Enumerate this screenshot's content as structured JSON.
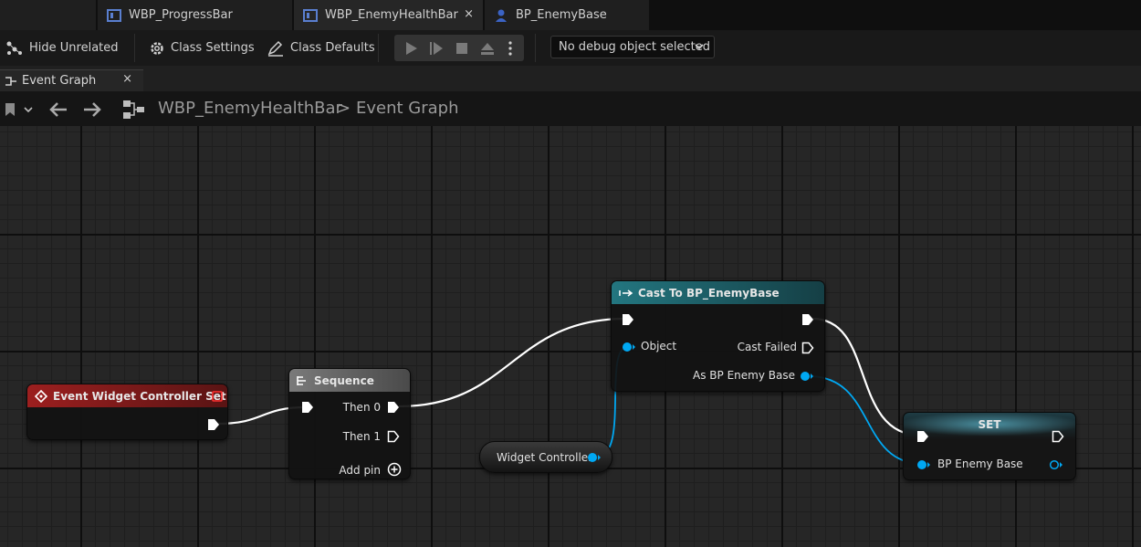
{
  "doc_tabs": [
    {
      "label": "WBP_ProgressBar",
      "icon": "widget-blueprint-icon"
    },
    {
      "label": "WBP_EnemyHealthBar",
      "icon": "widget-blueprint-icon",
      "close": "×"
    },
    {
      "label": "BP_EnemyBase",
      "icon": "actor-blueprint-icon"
    }
  ],
  "toolbar": {
    "hide_unrelated": "Hide Unrelated",
    "class_settings": "Class Settings",
    "class_defaults": "Class Defaults",
    "debug_object": "No debug object selected"
  },
  "graph_tab": {
    "label": "Event Graph",
    "close": "×"
  },
  "breadcrumb": {
    "asset": "WBP_EnemyHealthBar",
    "separator": ">",
    "graph": "Event Graph"
  },
  "nodes": {
    "event": {
      "title": "Event Widget Controller Set"
    },
    "sequence": {
      "title": "Sequence",
      "then0": "Then 0",
      "then1": "Then 1",
      "add_pin": "Add pin"
    },
    "cast": {
      "title": "Cast To BP_EnemyBase",
      "object": "Object",
      "cast_failed": "Cast Failed",
      "as_enemy": "As BP Enemy Base"
    },
    "getter": {
      "label": "Widget Controller"
    },
    "set": {
      "title": "SET",
      "input": "BP Enemy Base"
    }
  },
  "colors": {
    "event_header": "#8b1c1c",
    "sequence_header": "#6b6b6b",
    "cast_header": "#1f6a72",
    "set_header": "#2b5f6a",
    "object_pin": "#00a8f3",
    "exec_wire": "#ffffff"
  }
}
